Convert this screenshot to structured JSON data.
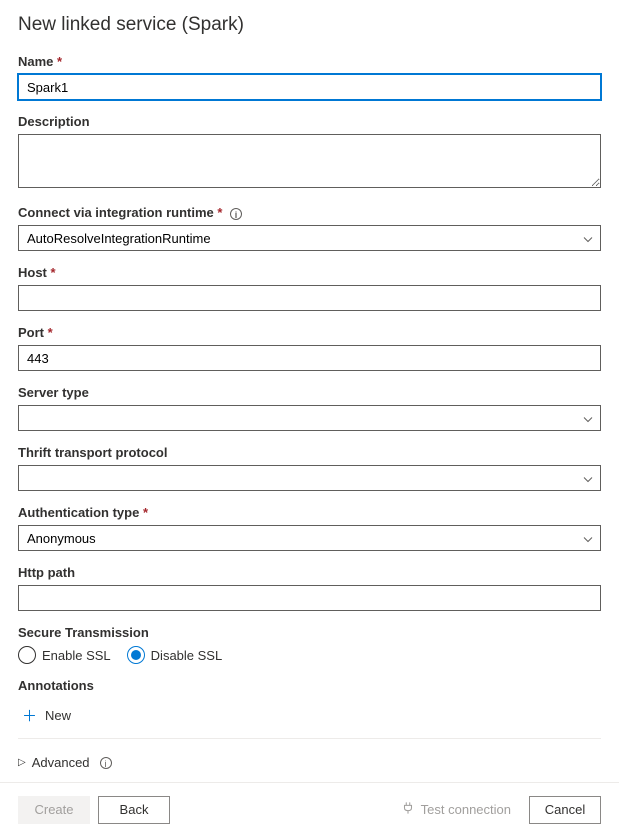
{
  "header": {
    "title": "New linked service (Spark)"
  },
  "fields": {
    "name": {
      "label": "Name",
      "value": "Spark1"
    },
    "description": {
      "label": "Description",
      "value": ""
    },
    "runtime": {
      "label": "Connect via integration runtime",
      "value": "AutoResolveIntegrationRuntime"
    },
    "host": {
      "label": "Host",
      "value": ""
    },
    "port": {
      "label": "Port",
      "value": "443"
    },
    "server_type": {
      "label": "Server type",
      "value": ""
    },
    "thrift": {
      "label": "Thrift transport protocol",
      "value": ""
    },
    "auth_type": {
      "label": "Authentication type",
      "value": "Anonymous"
    },
    "http_path": {
      "label": "Http path",
      "value": ""
    }
  },
  "secure_transmission": {
    "label": "Secure Transmission",
    "enable_label": "Enable SSL",
    "disable_label": "Disable SSL",
    "selected": "disable"
  },
  "annotations": {
    "label": "Annotations",
    "new_label": "New"
  },
  "advanced": {
    "label": "Advanced"
  },
  "footer": {
    "create": "Create",
    "back": "Back",
    "test_connection": "Test connection",
    "cancel": "Cancel"
  }
}
